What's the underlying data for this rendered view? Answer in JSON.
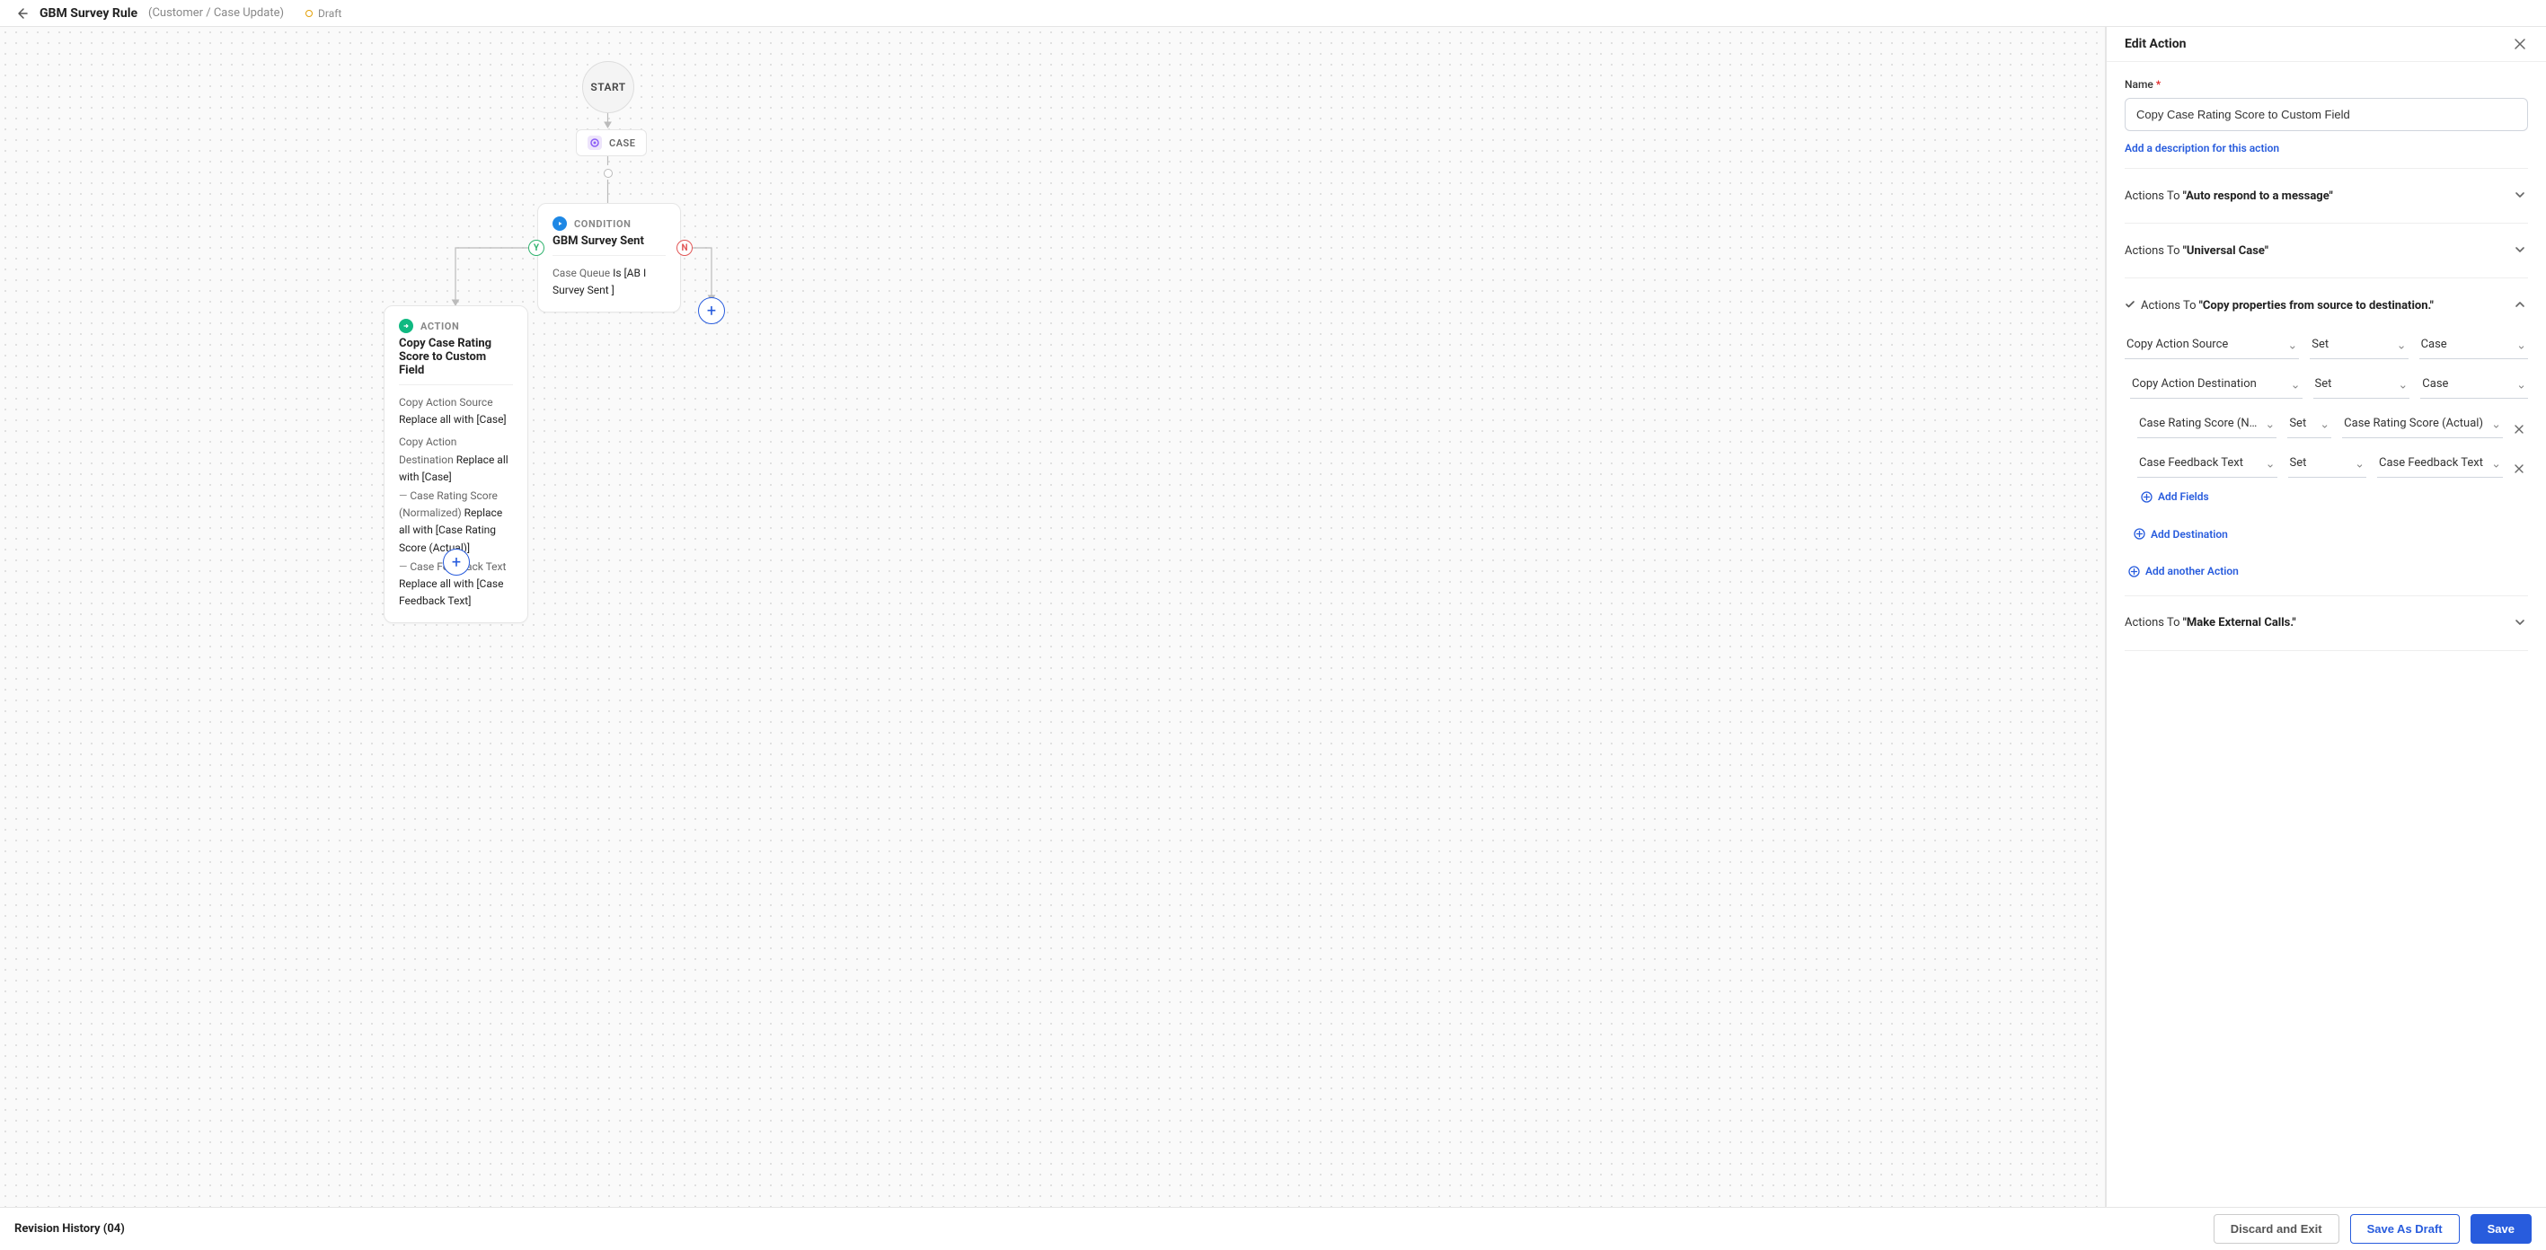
{
  "header": {
    "title": "GBM Survey Rule",
    "subtitle": "(Customer / Case Update)",
    "status": "Draft"
  },
  "canvas": {
    "start_label": "START",
    "case_pill_label": "CASE",
    "condition": {
      "type_label": "CONDITION",
      "title": "GBM Survey Sent",
      "body_gray": "Case Queue",
      "body_bold": " Is [AB I Survey Sent ]"
    },
    "action": {
      "type_label": "ACTION",
      "title": "Copy Case Rating Score to Custom Field",
      "line1_gray": "Copy Action Source",
      "line1_bold": " Replace all with [Case]",
      "line2_gray": "Copy Action Destination",
      "line2_bold": "Replace all with [Case]",
      "line3_gray": "Case Rating Score (Normalized)",
      "line3_bold": " Replace all with [Case Rating Score (Actual)]",
      "line4_gray": "Case Feedback Text",
      "line4_bold": " Replace all with [Case Feedback Text]"
    }
  },
  "panel": {
    "title": "Edit Action",
    "name_label": "Name",
    "name_value": "Copy Case Rating Score to Custom Field",
    "add_description": "Add a description for this action",
    "actions_to_prefix": "Actions To ",
    "accordions": {
      "a1": "\"Auto respond to a message\"",
      "a2": "\"Universal Case\"",
      "a3": "\"Copy properties from source to destination.\"",
      "a4": "\"Make External Calls.\""
    },
    "config": {
      "src_label": "Copy Action Source",
      "op_set": "Set",
      "case": "Case",
      "dst_label": "Copy Action Destination",
      "row1_a": "Case Rating Score (N…",
      "row1_c": "Case Rating Score (Actual)",
      "row2_a": "Case Feedback Text",
      "row2_c": "Case Feedback Text",
      "add_fields": "Add Fields",
      "add_destination": "Add Destination",
      "add_action": "Add another Action"
    }
  },
  "footer": {
    "revision": "Revision History (04)",
    "discard": "Discard and Exit",
    "save_draft": "Save As Draft",
    "save": "Save"
  }
}
